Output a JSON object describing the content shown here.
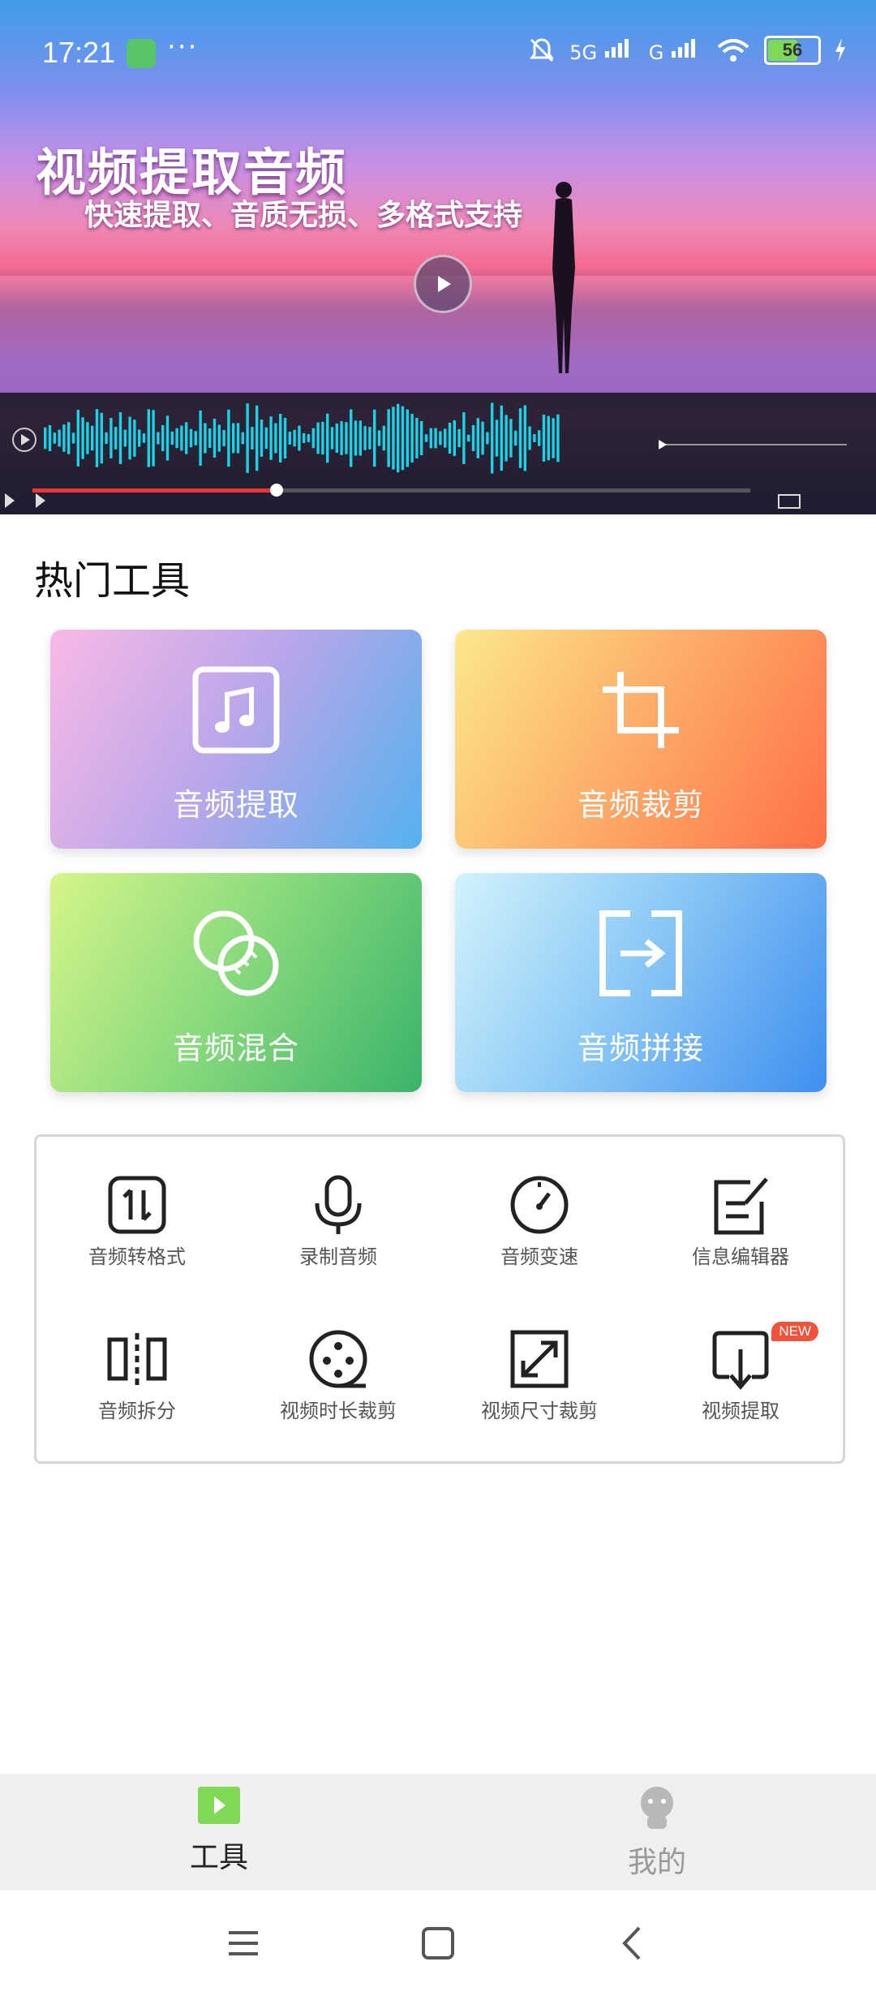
{
  "status_bar": {
    "time": "17:21",
    "dots": "···",
    "network_1": "5G",
    "network_2": "G",
    "battery": "56",
    "icons": [
      "tool-app-icon",
      "mute-bell-icon",
      "signal-icon",
      "wifi-icon",
      "battery-icon",
      "charging-icon"
    ]
  },
  "hero": {
    "title": "视频提取音频",
    "subtitle": "快速提取、音质无损、多格式支持",
    "progress": 0.34
  },
  "section": {
    "title": "热门工具"
  },
  "cards": [
    {
      "label": "音频提取",
      "icon": "music-note-icon"
    },
    {
      "label": "音频裁剪",
      "icon": "crop-icon"
    },
    {
      "label": "音频混合",
      "icon": "overlap-circles-icon"
    },
    {
      "label": "音频拼接",
      "icon": "join-arrow-icon"
    }
  ],
  "tools": [
    {
      "label": "音频转格式",
      "icon": "convert-arrows-icon"
    },
    {
      "label": "录制音频",
      "icon": "microphone-icon"
    },
    {
      "label": "音频变速",
      "icon": "speedometer-icon"
    },
    {
      "label": "信息编辑器",
      "icon": "edit-note-icon"
    },
    {
      "label": "音频拆分",
      "icon": "split-icon"
    },
    {
      "label": "视频时长裁剪",
      "icon": "film-reel-icon"
    },
    {
      "label": "视频尺寸裁剪",
      "icon": "resize-icon"
    },
    {
      "label": "视频提取",
      "icon": "download-box-icon",
      "badge": "NEW"
    }
  ],
  "bottom_nav": {
    "tools_label": "工具",
    "me_label": "我的",
    "active": "工具",
    "accent": "#7ed957"
  }
}
